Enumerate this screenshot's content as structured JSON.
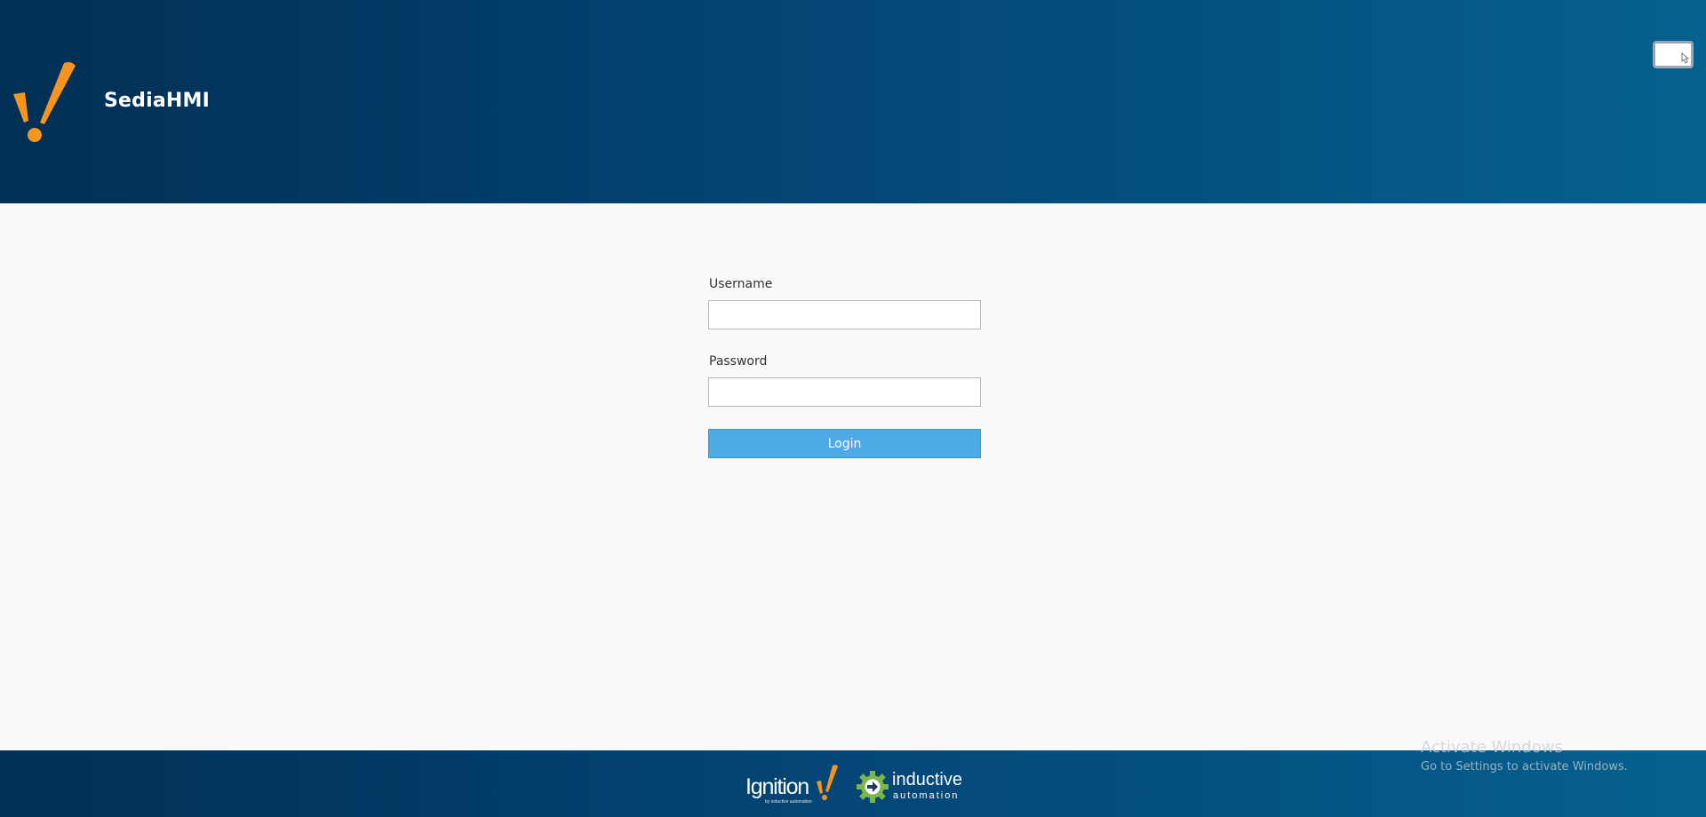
{
  "header": {
    "app_title": "SediaHMI",
    "logo_icon": "ignition-exclamation-icon",
    "fullscreen_icon": "fullscreen-toggle-icon"
  },
  "login": {
    "username_label": "Username",
    "username_value": "",
    "password_label": "Password",
    "password_value": "",
    "login_button_label": "Login"
  },
  "footer": {
    "ignition_logo_text": "Ignition",
    "ignition_logo_subtext": "by inductive automation",
    "ia_logo_line1": "inductive",
    "ia_logo_line2": "automation"
  },
  "watermark": {
    "title": "Activate Windows",
    "subtitle": "Go to Settings to activate Windows."
  },
  "colors": {
    "header_dark": "#012f55",
    "header_light": "#05618f",
    "accent_orange": "#f7941d",
    "login_button": "#4ea9e7",
    "ia_green": "#7ab648",
    "page_background": "#f9f9f9"
  }
}
